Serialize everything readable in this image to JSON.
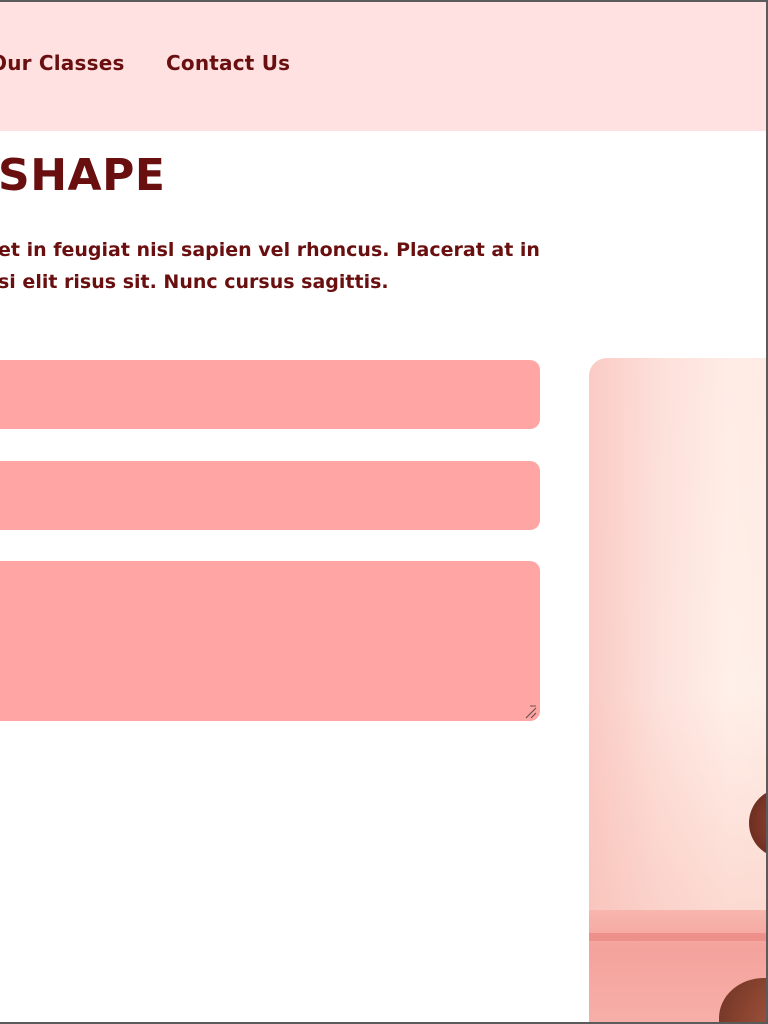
{
  "nav": {
    "items": [
      {
        "label": "Our Classes"
      },
      {
        "label": "Contact Us"
      }
    ]
  },
  "hero": {
    "title": "SHAPE",
    "description_line1": "et in feugiat nisl sapien vel rhoncus. Placerat at in",
    "description_line2": "si elit risus sit. Nunc cursus sagittis."
  },
  "form": {
    "name_value": "",
    "email_value": "",
    "message_value": ""
  },
  "colors": {
    "header_bg": "#ffe1e1",
    "text_brand": "#6a0f0f",
    "field_bg": "#ffa6a4"
  },
  "icons": {
    "resize": "resize-grip-icon"
  }
}
